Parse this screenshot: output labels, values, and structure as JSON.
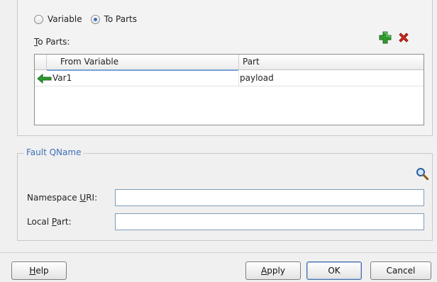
{
  "radio_group": {
    "option_variable": "Variable",
    "option_to_parts": "To Parts",
    "selected": "To Parts"
  },
  "to_parts": {
    "label_prefix": "",
    "label_mnemonic": "T",
    "label_rest": "o Parts:",
    "add_icon": "add-plus-icon",
    "delete_icon": "delete-x-icon",
    "columns": [
      "From Variable",
      "Part"
    ],
    "rows": [
      {
        "from_variable": "Var1",
        "part": "payload",
        "icon": "arrow-left-icon"
      }
    ]
  },
  "fault_qname": {
    "legend": "Fault QName",
    "search_icon": "magnifier-icon",
    "namespace_label_pre": "Namespace ",
    "namespace_label_mnemonic": "U",
    "namespace_label_post": "RI:",
    "namespace_value": "",
    "local_label_pre": "Local ",
    "local_label_mnemonic": "P",
    "local_label_post": "art:",
    "local_value": ""
  },
  "buttons": {
    "help_mnemonic": "H",
    "help_rest": "elp",
    "apply_mnemonic": "A",
    "apply_rest": "pply",
    "ok": "OK",
    "cancel": "Cancel"
  },
  "colors": {
    "accent_blue": "#3d6fb8",
    "add_green": "#2e9a2e",
    "delete_red": "#d42a1c"
  }
}
